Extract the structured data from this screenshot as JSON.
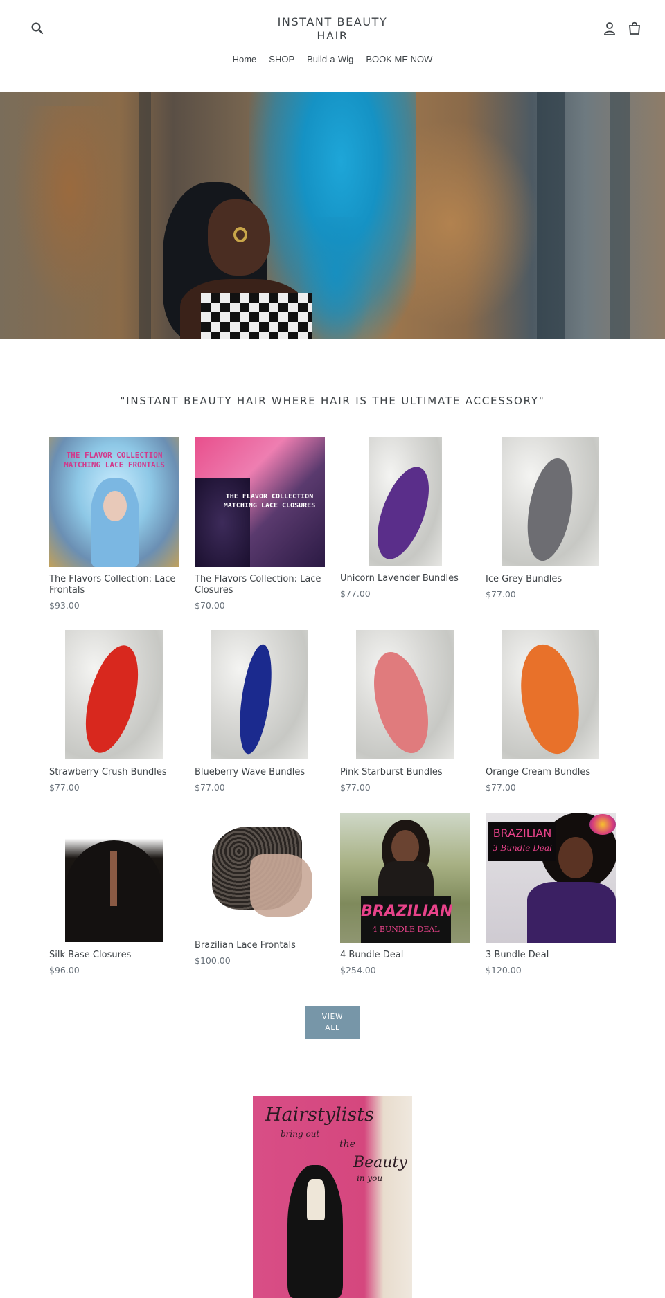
{
  "header": {
    "logo_line1": "INSTANT BEAUTY",
    "logo_line2": "HAIR",
    "search_icon": "search-icon",
    "account_icon": "account-icon",
    "cart_icon": "cart-icon"
  },
  "nav": {
    "items": [
      {
        "label": "Home"
      },
      {
        "label": "SHOP"
      },
      {
        "label": "Build-a-Wig"
      },
      {
        "label": "BOOK ME NOW"
      }
    ]
  },
  "tagline": "\"INSTANT BEAUTY HAIR WHERE HAIR IS THE ULTIMATE ACCESSORY\"",
  "products": [
    {
      "title": "The Flavors Collection: Lace Frontals",
      "price": "$93.00",
      "image_text": "THE FLAVOR COLLECTION MATCHING LACE FRONTALS"
    },
    {
      "title": "The Flavors Collection: Lace Closures",
      "price": "$70.00",
      "image_text": "THE FLAVOR COLLECTION MATCHING LACE CLOSURES"
    },
    {
      "title": "Unicorn Lavender Bundles",
      "price": "$77.00"
    },
    {
      "title": "Ice Grey Bundles",
      "price": "$77.00"
    },
    {
      "title": "Strawberry Crush Bundles",
      "price": "$77.00"
    },
    {
      "title": "Blueberry Wave Bundles",
      "price": "$77.00"
    },
    {
      "title": "Pink Starburst Bundles",
      "price": "$77.00"
    },
    {
      "title": "Orange Cream Bundles",
      "price": "$77.00"
    },
    {
      "title": "Silk Base Closures",
      "price": "$96.00"
    },
    {
      "title": "Brazilian Lace Frontals",
      "price": "$100.00"
    },
    {
      "title": "4 Bundle Deal",
      "price": "$254.00",
      "image_text_1": "BRAZILIAN",
      "image_text_2": "4 BUNDLE DEAL"
    },
    {
      "title": "3 Bundle Deal",
      "price": "$120.00",
      "image_text_1": "BRAZILIAN",
      "image_text_2": "3 Bundle Deal"
    }
  ],
  "view_all": {
    "line1": "VIEW",
    "line2": "ALL"
  },
  "promo": {
    "line1": "Hairstylists",
    "line2": "bring out",
    "line3": "the",
    "line4": "Beauty",
    "line5": "in you"
  },
  "colors": {
    "text": "#3d4246",
    "price": "#69727b",
    "button": "#7796a8",
    "hero_smoke": "#1ea6d8"
  }
}
